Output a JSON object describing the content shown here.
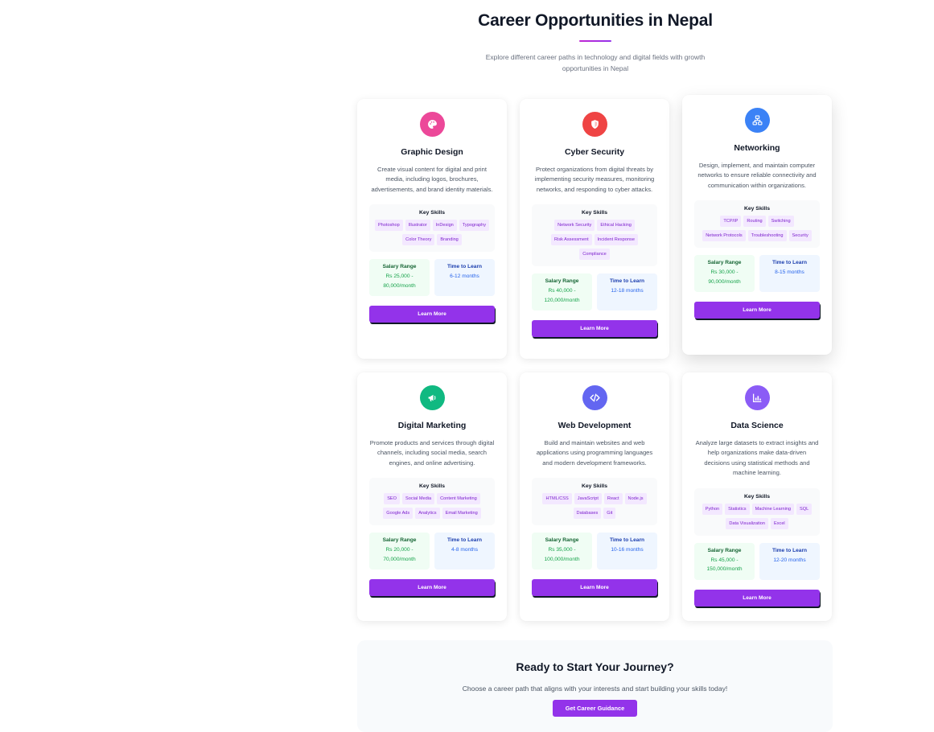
{
  "header": {
    "title": "Career Opportunities in Nepal",
    "subtitle": "Explore different career paths in technology and digital fields with growth opportunities in Nepal"
  },
  "labels": {
    "key_skills": "Key Skills",
    "salary_range": "Salary Range",
    "time_to_learn": "Time to Learn",
    "learn_more": "Learn More"
  },
  "careers": [
    {
      "title": "Graphic Design",
      "icon": "palette-icon",
      "color": "#ec4899",
      "description": "Create visual content for digital and print media, including logos, brochures, advertisements, and brand identity materials.",
      "skills": [
        "Photoshop",
        "Illustrator",
        "InDesign",
        "Typography",
        "Color Theory",
        "Branding"
      ],
      "salary": "Rs 25,000 - 80,000/month",
      "time": "6-12 months"
    },
    {
      "title": "Cyber Security",
      "icon": "shield-icon",
      "color": "#ef4444",
      "description": "Protect organizations from digital threats by implementing security measures, monitoring networks, and responding to cyber attacks.",
      "skills": [
        "Network Security",
        "Ethical Hacking",
        "Risk Assessment",
        "Incident Response",
        "Compliance"
      ],
      "salary": "Rs 40,000 - 120,000/month",
      "time": "12-18 months"
    },
    {
      "title": "Networking",
      "icon": "network-icon",
      "color": "#3b82f6",
      "description": "Design, implement, and maintain computer networks to ensure reliable connectivity and communication within organizations.",
      "skills": [
        "TCP/IP",
        "Routing",
        "Switching",
        "Network Protocols",
        "Troubleshooting",
        "Security"
      ],
      "salary": "Rs 30,000 - 90,000/month",
      "time": "8-15 months"
    },
    {
      "title": "Digital Marketing",
      "icon": "megaphone-icon",
      "color": "#10b981",
      "description": "Promote products and services through digital channels, including social media, search engines, and online advertising.",
      "skills": [
        "SEO",
        "Social Media",
        "Content Marketing",
        "Google Ads",
        "Analytics",
        "Email Marketing"
      ],
      "salary": "Rs 20,000 - 70,000/month",
      "time": "4-8 months"
    },
    {
      "title": "Web Development",
      "icon": "code-icon",
      "color": "#6366f1",
      "description": "Build and maintain websites and web applications using programming languages and modern development frameworks.",
      "skills": [
        "HTML/CSS",
        "JavaScript",
        "React",
        "Node.js",
        "Databases",
        "Git"
      ],
      "salary": "Rs 35,000 - 100,000/month",
      "time": "10-16 months"
    },
    {
      "title": "Data Science",
      "icon": "chart-icon",
      "color": "#8b5cf6",
      "description": "Analyze large datasets to extract insights and help organizations make data-driven decisions using statistical methods and machine learning.",
      "skills": [
        "Python",
        "Statistics",
        "Machine Learning",
        "SQL",
        "Data Visualization",
        "Excel"
      ],
      "salary": "Rs 45,000 - 150,000/month",
      "time": "12-20 months"
    }
  ],
  "cta": {
    "title": "Ready to Start Your Journey?",
    "text": "Choose a career path that aligns with your interests and start building your skills today!",
    "button": "Get Career Guidance"
  }
}
